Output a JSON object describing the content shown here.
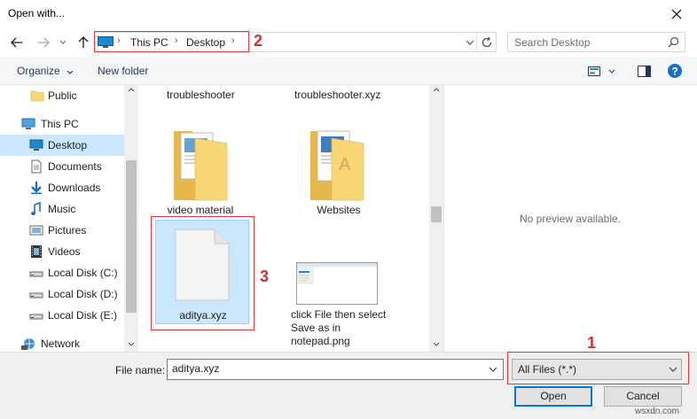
{
  "window": {
    "title": "Open with..."
  },
  "nav": {
    "breadcrumb": [
      "This PC",
      "Desktop"
    ],
    "search_placeholder": "Search Desktop"
  },
  "toolbar": {
    "organize": "Organize",
    "new_folder": "New folder"
  },
  "sidebar": {
    "items": [
      {
        "label": "Public",
        "icon": "folder-icon"
      },
      {
        "label": "This PC",
        "icon": "pc-icon"
      },
      {
        "label": "Desktop",
        "icon": "desktop-icon",
        "selected": true
      },
      {
        "label": "Documents",
        "icon": "documents-icon"
      },
      {
        "label": "Downloads",
        "icon": "downloads-icon"
      },
      {
        "label": "Music",
        "icon": "music-icon"
      },
      {
        "label": "Pictures",
        "icon": "pictures-icon"
      },
      {
        "label": "Videos",
        "icon": "videos-icon"
      },
      {
        "label": "Local Disk (C:)",
        "icon": "drive-icon"
      },
      {
        "label": "Local Disk (D:)",
        "icon": "drive-icon"
      },
      {
        "label": "Local Disk (E:)",
        "icon": "drive-icon"
      },
      {
        "label": "Network",
        "icon": "network-icon"
      }
    ]
  },
  "files": {
    "top_left_label": "troubleshooter",
    "top_right_label": "troubleshooter.xyz",
    "video_material": "video material",
    "websites": "Websites",
    "aditya": "aditya.xyz",
    "notepad_png": "click File then select Save as in notepad.png"
  },
  "preview": {
    "text": "No preview available."
  },
  "bottom": {
    "filename_label": "File name:",
    "filename_value": "aditya.xyz",
    "filetype_value": "All Files (*.*)",
    "open_label": "Open",
    "cancel_label": "Cancel"
  },
  "annotations": {
    "one": "1",
    "two": "2",
    "three": "3"
  },
  "watermark": "wsxdn.com",
  "colors": {
    "selection": "#cce8ff",
    "annotation": "#e23b3b",
    "accent": "#0078d7",
    "folder": "#f8d775"
  }
}
